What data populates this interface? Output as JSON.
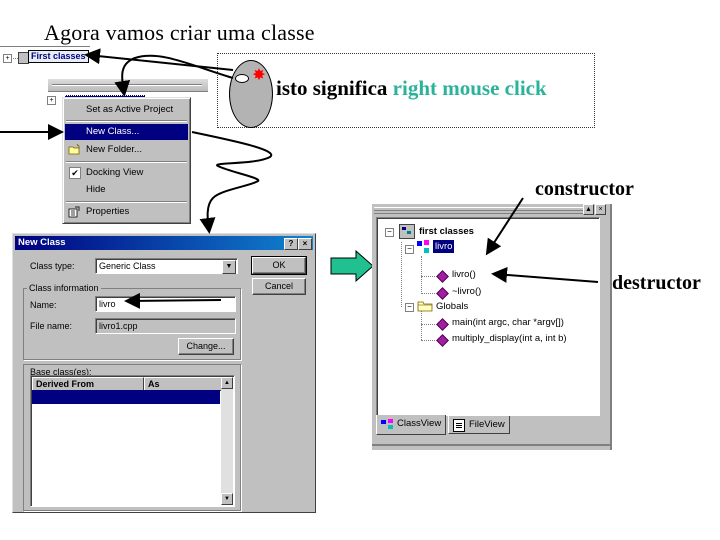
{
  "slide": {
    "title": "Agora vamos criar uma classe",
    "callout": {
      "prefix": "isto significa",
      "highlight": "right mouse click",
      "highlight_color": "#2bb39a"
    },
    "annotations": {
      "constructor": "constructor",
      "destructor": "destructor"
    }
  },
  "workspace_tree": {
    "root_label": "First classes",
    "expander": "+"
  },
  "context_menu": {
    "items": [
      {
        "label": "Set as Active Project",
        "icon": "",
        "highlighted": false
      },
      {
        "label": "New Class...",
        "icon": "",
        "highlighted": true
      },
      {
        "label": "New Folder...",
        "icon": "new-folder-icon",
        "highlighted": false
      },
      {
        "label": "Docking View",
        "icon": "check-icon",
        "highlighted": false
      },
      {
        "label": "Hide",
        "icon": "",
        "highlighted": false
      },
      {
        "label": "Properties",
        "icon": "properties-icon",
        "highlighted": false
      }
    ]
  },
  "new_class_dialog": {
    "title": "New Class",
    "help_button": "?",
    "close_button": "×",
    "class_type_label": "Class type:",
    "class_type_value": "Generic Class",
    "group_label": "Class information",
    "name_label": "Name:",
    "name_value": "livro",
    "file_name_label": "File name:",
    "file_name_value": "livro1.cpp",
    "change_button": "Change...",
    "base_classes_label": "Base class(es):",
    "columns": [
      "Derived From",
      "As"
    ],
    "ok_button": "OK",
    "cancel_button": "Cancel"
  },
  "class_view": {
    "root": "first classes",
    "class_node": "livro",
    "members": [
      "livro()",
      "~livro()"
    ],
    "globals_label": "Globals",
    "globals": [
      "main(int argc, char *argv[])",
      "multiply_display(int a, int b)"
    ],
    "tabs": [
      "ClassView",
      "FileView"
    ],
    "active_tab": "ClassView"
  }
}
